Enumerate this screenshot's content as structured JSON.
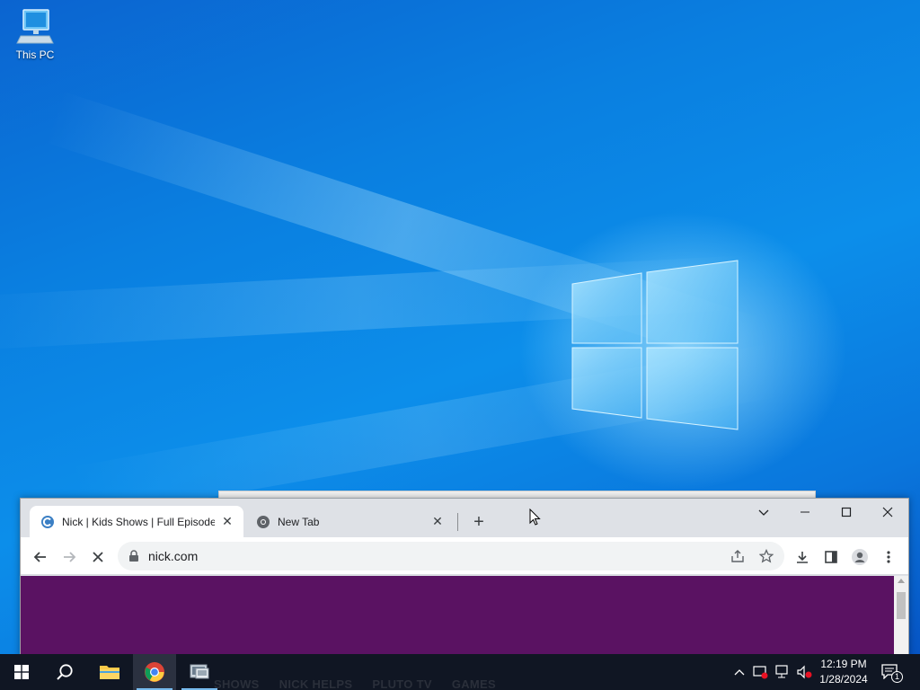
{
  "desktop": {
    "icons": [
      {
        "label": "This PC",
        "icon": "computer-icon"
      }
    ]
  },
  "browser": {
    "tabs": [
      {
        "title": "Nick | Kids Shows | Full Episodes",
        "icon": "nick-favicon",
        "active": true
      },
      {
        "title": "New Tab",
        "icon": "chrome-favicon",
        "active": false
      }
    ],
    "url": "nick.com",
    "page": {
      "background": "#5a1262",
      "nav_links": [
        "SHOWS",
        "NICK HELPS",
        "PLUTO TV",
        "GAMES"
      ]
    }
  },
  "taskbar": {
    "apps": [
      "start-icon",
      "search-icon",
      "file-explorer-icon",
      "chrome-icon",
      "app-icon"
    ],
    "clock": {
      "time": "12:19 PM",
      "date": "1/28/2024"
    },
    "notification_count": "1"
  }
}
